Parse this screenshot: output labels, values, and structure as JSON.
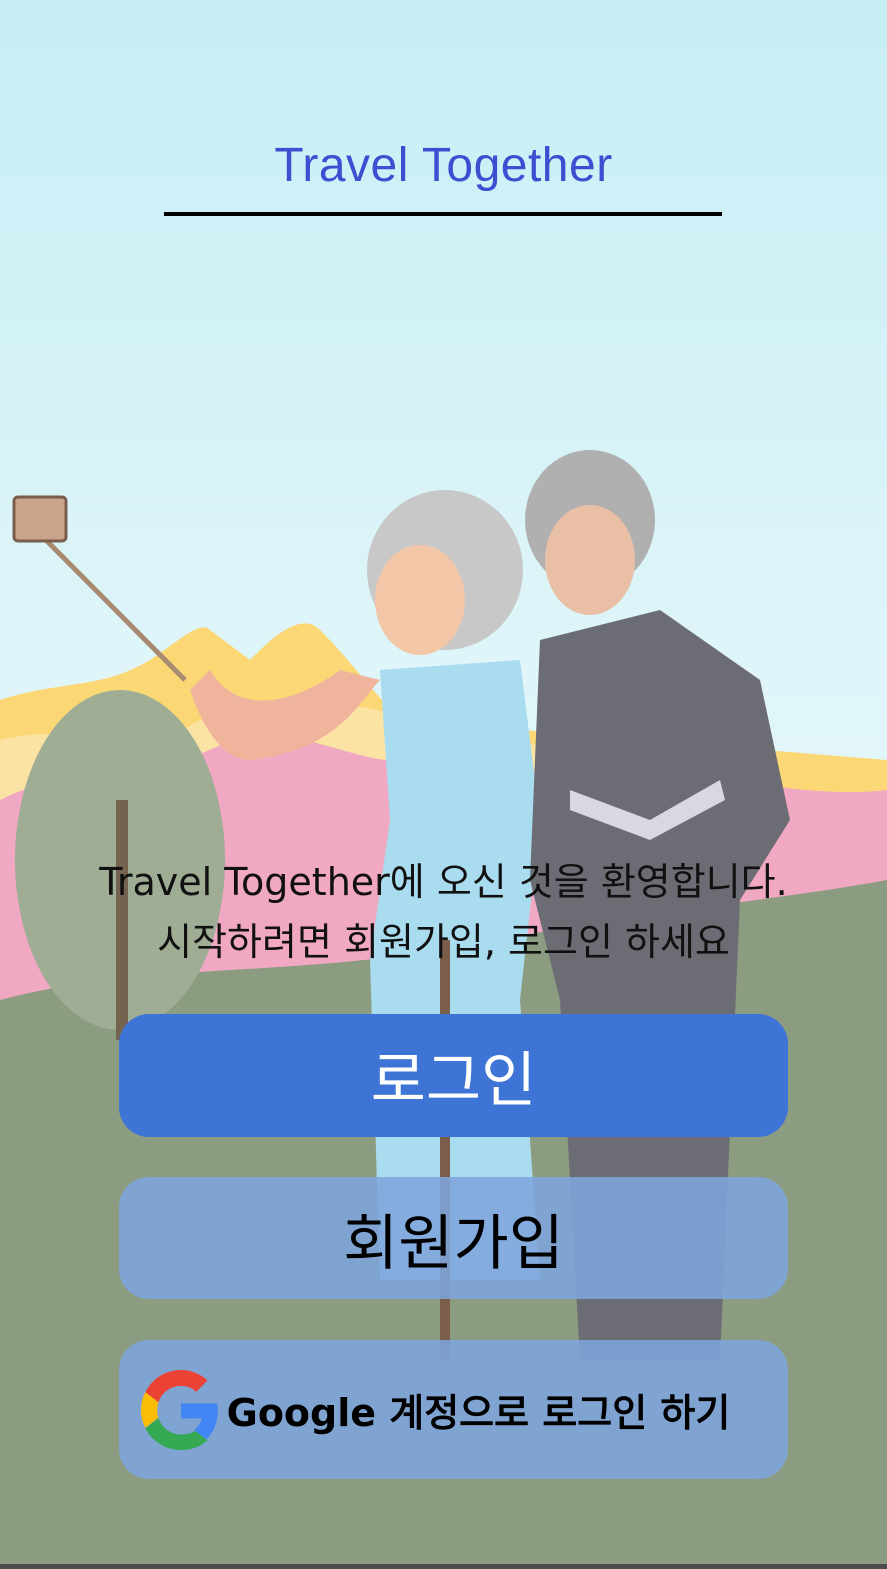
{
  "header": {
    "title": "Travel Together"
  },
  "welcome": {
    "line1": "Travel Together에 오신 것을 환영합니다.",
    "line2": "시작하려면 회원가입, 로그인 하세요"
  },
  "buttons": {
    "login_label": "로그인",
    "signup_label": "회원가입",
    "google_label": "Google 계정으로 로그인 하기"
  },
  "icons": {
    "google": "google-g-icon"
  },
  "colors": {
    "title": "#3b4fd0",
    "login_button": "#3d74d6",
    "secondary_button": "#7ea5dc",
    "sky_top": "#c8eef5",
    "ground": "#8c9c80"
  }
}
